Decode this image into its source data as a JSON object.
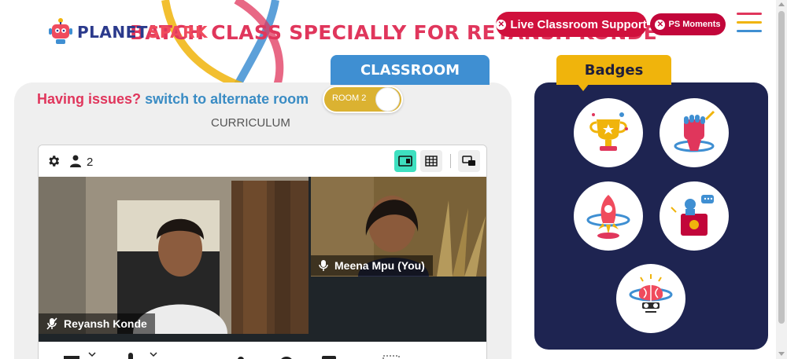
{
  "header": {
    "logo_text_a": "PLANET",
    "logo_text_b": "SPARK",
    "title": "BATCH CLASS SPECIALLY FOR REYANSH KONDE",
    "support_button": "Live Classroom Support",
    "moments_button": "PS Moments"
  },
  "classroom": {
    "tab_label": "CLASSROOM",
    "issues_question": "Having issues?",
    "issues_link": "switch to alternate room",
    "room_toggle": "ROOM 2",
    "curriculum": "CURRICULUM"
  },
  "video": {
    "participant_count": "2",
    "participants": [
      {
        "name": "Reyansh Konde",
        "mic": "mic-off-icon"
      },
      {
        "name": "Meena Mpu (You)",
        "mic": "mic-icon"
      }
    ]
  },
  "badges": {
    "tab_label": "Badges",
    "items": [
      "trophy-badge",
      "fist-badge",
      "rocket-badge",
      "speaker-badge",
      "brain-badge"
    ]
  },
  "colors": {
    "brand_red": "#d0103c",
    "title_pink": "#e0365c",
    "classroom_blue": "#3f8fd2",
    "badge_yellow": "#f0b40c",
    "badge_navy": "#1e2451"
  }
}
